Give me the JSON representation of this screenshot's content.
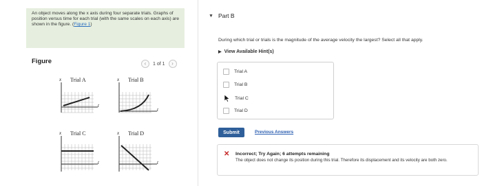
{
  "problem": {
    "text": "An object moves along the x axis during four separate trials. Graphs of position versus time for each trial (with the same scales on each axis) are shown in the figure. (",
    "figure_link": "Figure 1",
    "text_end": ")"
  },
  "figure": {
    "heading": "Figure",
    "pager_text": "1 of 1",
    "prev_symbol": "‹",
    "next_symbol": "›",
    "axis_x": "x",
    "axis_t": "t",
    "trials": [
      {
        "label": "Trial A"
      },
      {
        "label": "Trial B"
      },
      {
        "label": "Trial C"
      },
      {
        "label": "Trial D"
      }
    ]
  },
  "part": {
    "title": "Part B",
    "question": "During which trial or trials is the magnitude of the average velocity the largest?  Select all that apply.",
    "hints_label": "View Available Hint(s)",
    "choices": [
      {
        "label": "Trial A"
      },
      {
        "label": "Trial B"
      },
      {
        "label": "Trial C"
      },
      {
        "label": "Trial D"
      }
    ],
    "submit_label": "Submit",
    "previous_answers_label": "Previous Answers"
  },
  "feedback": {
    "title": "Incorrect; Try Again; 6 attempts remaining",
    "text": "The object does not change its position during this trial. Therefore its displacement and its velocity are both zero.",
    "x_color": "#c62828"
  }
}
